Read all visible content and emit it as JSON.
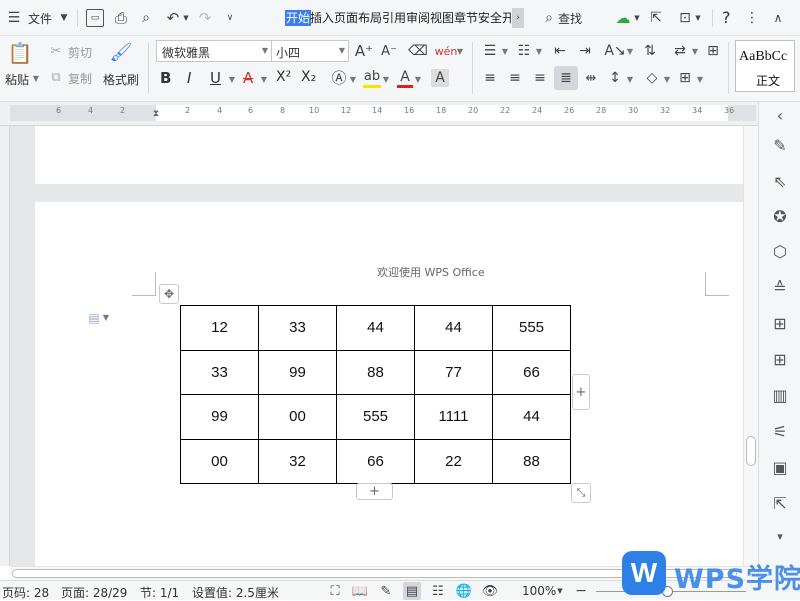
{
  "topbar": {
    "menu_icon": "hamburger-icon",
    "file_label": "文件",
    "tabs": [
      "开始",
      "插入",
      "页面布局",
      "引用",
      "审阅",
      "视图",
      "章节",
      "安全",
      "开"
    ],
    "active_tab": "开始",
    "search_label": "查找",
    "help": "?"
  },
  "ribbon": {
    "paste_label": "粘贴",
    "cut_label": "剪切",
    "copy_label": "复制",
    "format_painter_label": "格式刷",
    "font_name": "微软雅黑",
    "font_size": "小四",
    "bold": "B",
    "italic": "I",
    "underline": "U",
    "strike": "A",
    "superscript": "X²",
    "subscript": "X₂",
    "style_sample": "AaBbCc",
    "style_name": "正文"
  },
  "ruler": {
    "ticks": [
      "6",
      "4",
      "2",
      "2",
      "4",
      "6",
      "8",
      "10",
      "12",
      "14",
      "16",
      "18",
      "20",
      "22",
      "24",
      "26",
      "28",
      "30",
      "32",
      "34",
      "36"
    ]
  },
  "document": {
    "header_text": "欢迎使用 WPS Office",
    "table": [
      [
        "12",
        "33",
        "44",
        "44",
        "555"
      ],
      [
        "33",
        "99",
        "88",
        "77",
        "66"
      ],
      [
        "99",
        "00",
        "555",
        "1111",
        "44"
      ],
      [
        "00",
        "32",
        "66",
        "22",
        "88"
      ]
    ]
  },
  "status": {
    "page_code": "页码: 28",
    "page_count": "页面: 28/29",
    "section": "节: 1/1",
    "setting": "设置值: 2.5厘米",
    "zoom": "100%"
  },
  "watermark": {
    "text": "WPS学院"
  },
  "colors": {
    "accent": "#3d7eea",
    "canvas_bg": "#e6e7e9",
    "watermark": "#2f80e6"
  }
}
